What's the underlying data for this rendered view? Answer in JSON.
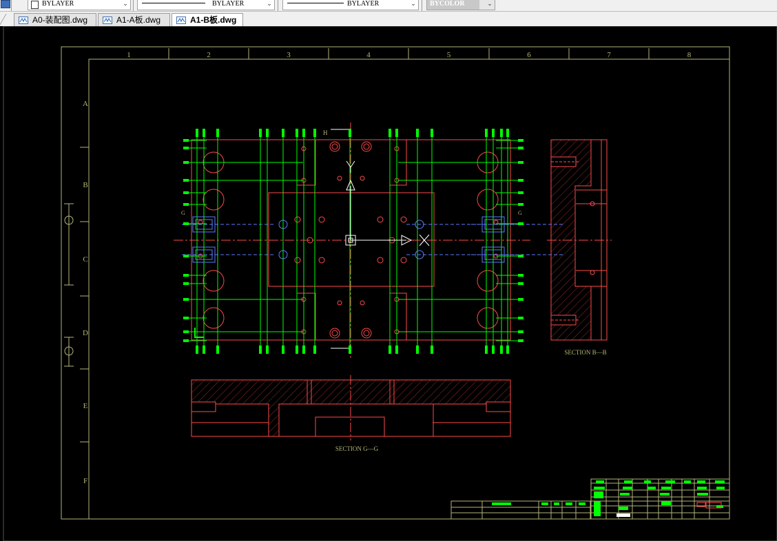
{
  "toolbar": {
    "color_combo": "BYLAYER",
    "linetype_combo": "BYLAYER",
    "lineweight_combo": "BYLAYER",
    "plotstyle_combo": "BYCOLOR"
  },
  "tabs": [
    {
      "label": "A0-装配图.dwg",
      "active": false
    },
    {
      "label": "A1-A板.dwg",
      "active": false
    },
    {
      "label": "A1-B板.dwg",
      "active": true
    }
  ],
  "drawing": {
    "column_labels": [
      "1",
      "2",
      "3",
      "4",
      "5",
      "6",
      "7",
      "8"
    ],
    "row_labels": [
      "A",
      "B",
      "C",
      "D",
      "E",
      "F"
    ],
    "section_bb": "SECTION B—B",
    "section_gg": "SECTION G—G",
    "marker_h": "H",
    "marker_g": "G",
    "axis_y": "Y",
    "axis_x": "X"
  },
  "colors": {
    "frame": "#b6b67a",
    "green": "#00ff00",
    "red": "#ff4a4a",
    "white": "#ffffff",
    "blue": "#5a7cff"
  }
}
